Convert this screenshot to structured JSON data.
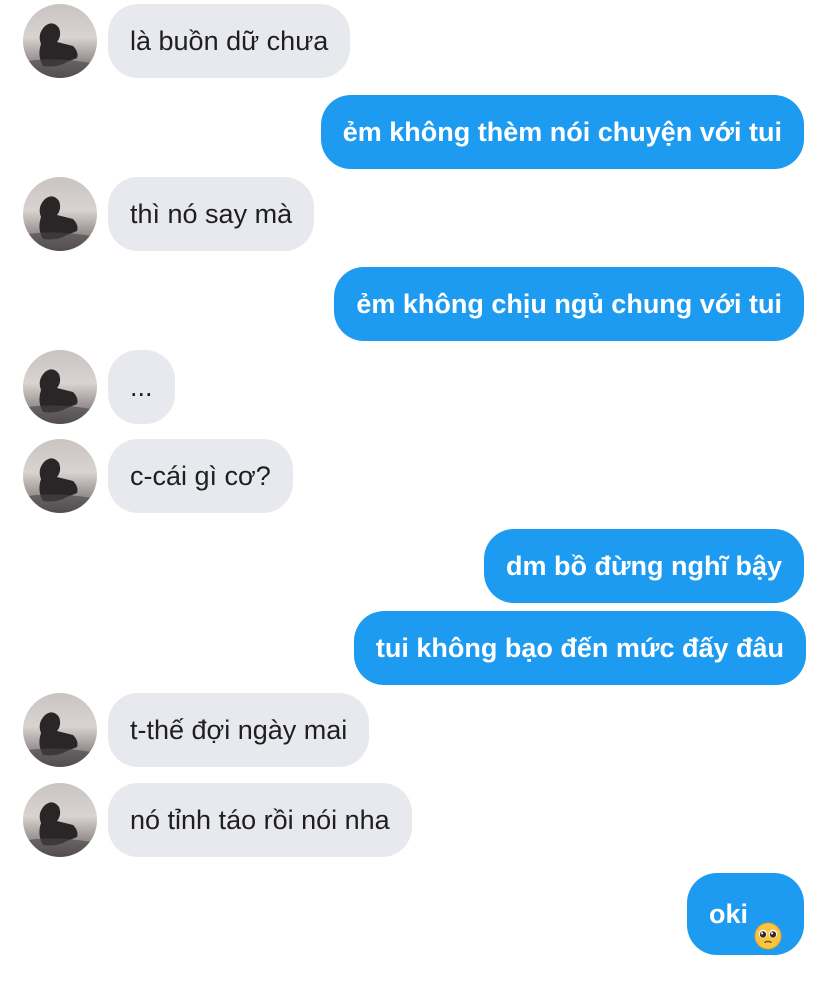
{
  "conversation": {
    "messages": [
      {
        "side": "in",
        "text": "là buồn dữ chưa"
      },
      {
        "side": "out",
        "text": "ẻm không thèm nói chuyện với tui"
      },
      {
        "side": "in",
        "text": "thì nó say mà"
      },
      {
        "side": "out",
        "text": "ẻm không chịu ngủ chung với tui"
      },
      {
        "side": "in",
        "text": "..."
      },
      {
        "side": "in",
        "text": "c-cái gì cơ?"
      },
      {
        "side": "out",
        "text": "dm bồ đừng nghĩ bậy"
      },
      {
        "side": "out",
        "text": "tui không bạo đến mức đấy đâu"
      },
      {
        "side": "in",
        "text": "t-thế đợi ngày mai"
      },
      {
        "side": "in",
        "text": "nó tỉnh táo rồi nói nha"
      },
      {
        "side": "out",
        "text": "oki",
        "emoji": "pleading-face-emoji"
      }
    ]
  },
  "colors": {
    "incoming_bubble": "#e7e9ee",
    "outgoing_bubble": "#1d9bf0",
    "incoming_text": "#1f1f1f",
    "outgoing_text": "#ffffff"
  }
}
